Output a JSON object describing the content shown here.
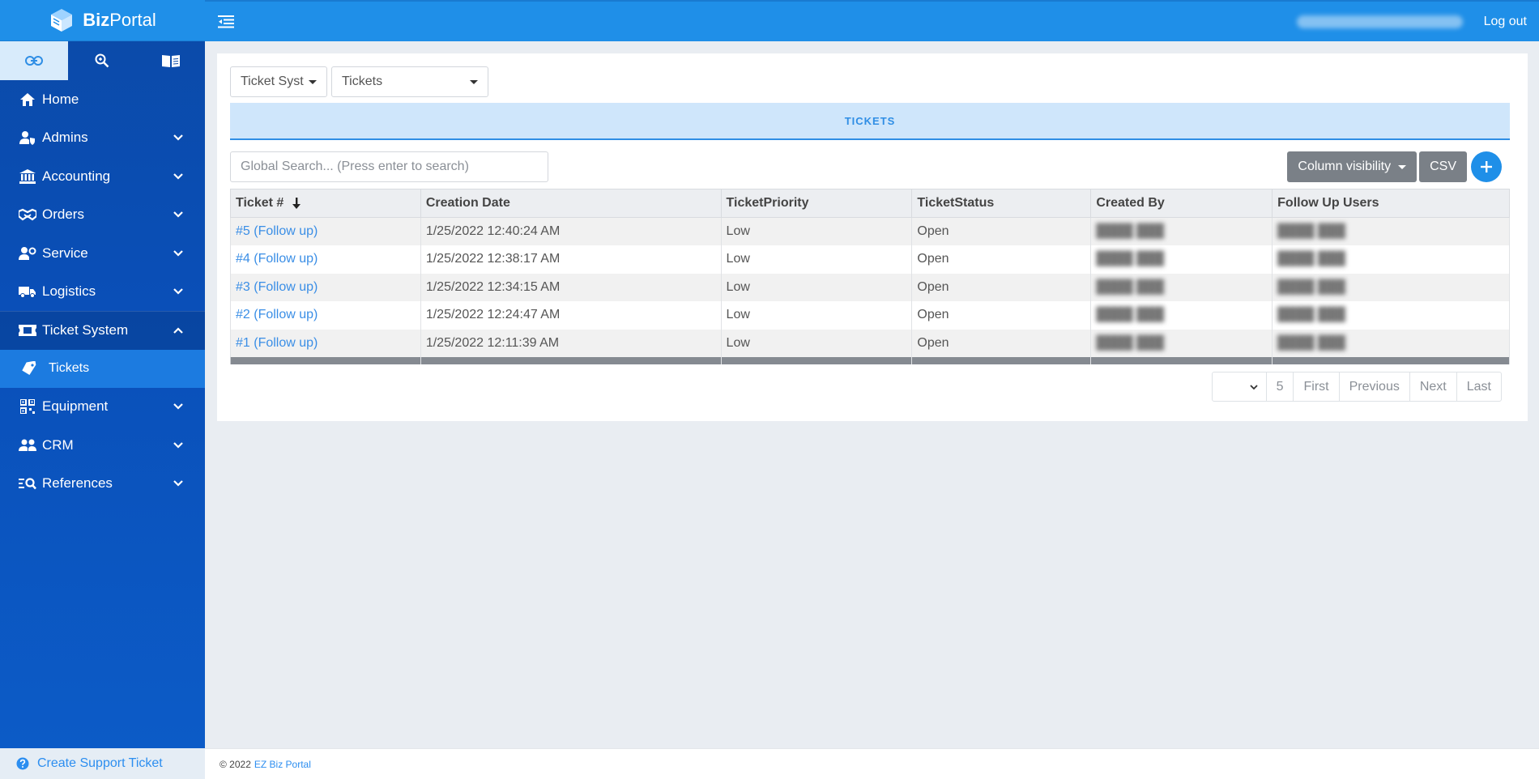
{
  "brand": {
    "bold": "Biz",
    "regular": "Portal"
  },
  "sidebar_tabs": [
    {
      "name": "link-icon",
      "active": true
    },
    {
      "name": "search-icon",
      "active": false
    },
    {
      "name": "book-icon",
      "active": false
    }
  ],
  "nav": {
    "home": "Home",
    "admins": "Admins",
    "accounting": "Accounting",
    "orders": "Orders",
    "service": "Service",
    "logistics": "Logistics",
    "ticket_system": "Ticket System",
    "tickets": "Tickets",
    "equipment": "Equipment",
    "crm": "CRM",
    "references": "References"
  },
  "support_link": "Create Support Ticket",
  "topbar": {
    "logout": "Log out"
  },
  "breadcrumb": {
    "system": "Ticket System",
    "page": "Tickets"
  },
  "section_title": "TICKETS",
  "search": {
    "placeholder": "Global Search... (Press enter to search)"
  },
  "toolbar": {
    "column_visibility": "Column visibility",
    "csv": "CSV"
  },
  "table": {
    "headers": [
      "Ticket #",
      "Creation Date",
      "TicketPriority",
      "TicketStatus",
      "Created By",
      "Follow Up Users"
    ],
    "rows": [
      {
        "ticket": "#5 (Follow up)",
        "date": "1/25/2022 12:40:24 AM",
        "priority": "Low",
        "status": "Open"
      },
      {
        "ticket": "#4 (Follow up)",
        "date": "1/25/2022 12:38:17 AM",
        "priority": "Low",
        "status": "Open"
      },
      {
        "ticket": "#3 (Follow up)",
        "date": "1/25/2022 12:34:15 AM",
        "priority": "Low",
        "status": "Open"
      },
      {
        "ticket": "#2 (Follow up)",
        "date": "1/25/2022 12:24:47 AM",
        "priority": "Low",
        "status": "Open"
      },
      {
        "ticket": "#1 (Follow up)",
        "date": "1/25/2022 12:11:39 AM",
        "priority": "Low",
        "status": "Open"
      }
    ]
  },
  "pager": {
    "count": "5",
    "first": "First",
    "previous": "Previous",
    "next": "Next",
    "last": "Last"
  },
  "footer": {
    "copyright": "© 2022",
    "brand": "EZ Biz Portal"
  },
  "colors": {
    "primary": "#1f8fe8",
    "sidebar": "#0b4aa8",
    "link": "#3a8ee6"
  }
}
